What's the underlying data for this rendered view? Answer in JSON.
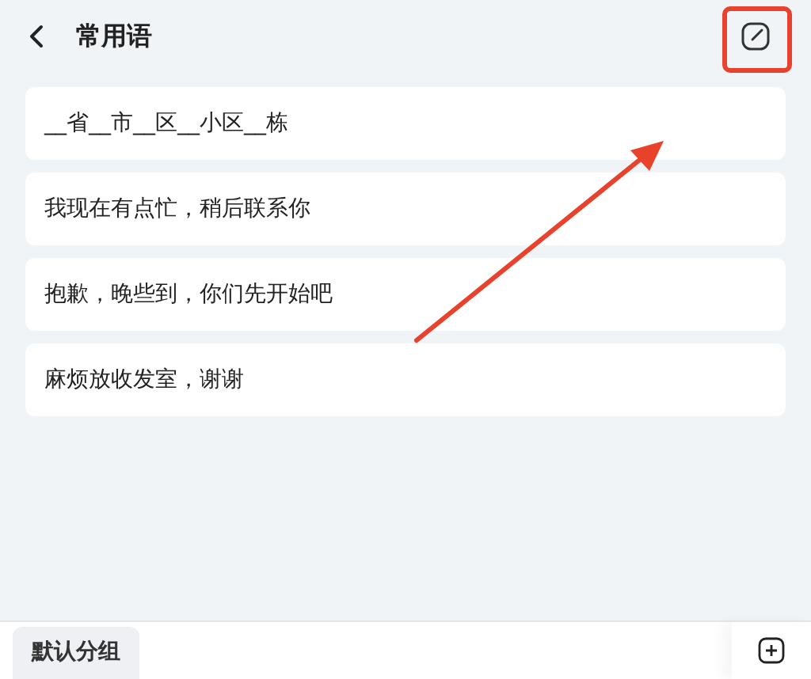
{
  "header": {
    "title": "常用语"
  },
  "phrases": [
    "__省__市__区__小区__栋",
    "我现在有点忙，稍后联系你",
    "抱歉，晚些到，你们先开始吧",
    "麻烦放收发室，谢谢"
  ],
  "groups": [
    {
      "label": "默认分组",
      "selected": true
    }
  ]
}
